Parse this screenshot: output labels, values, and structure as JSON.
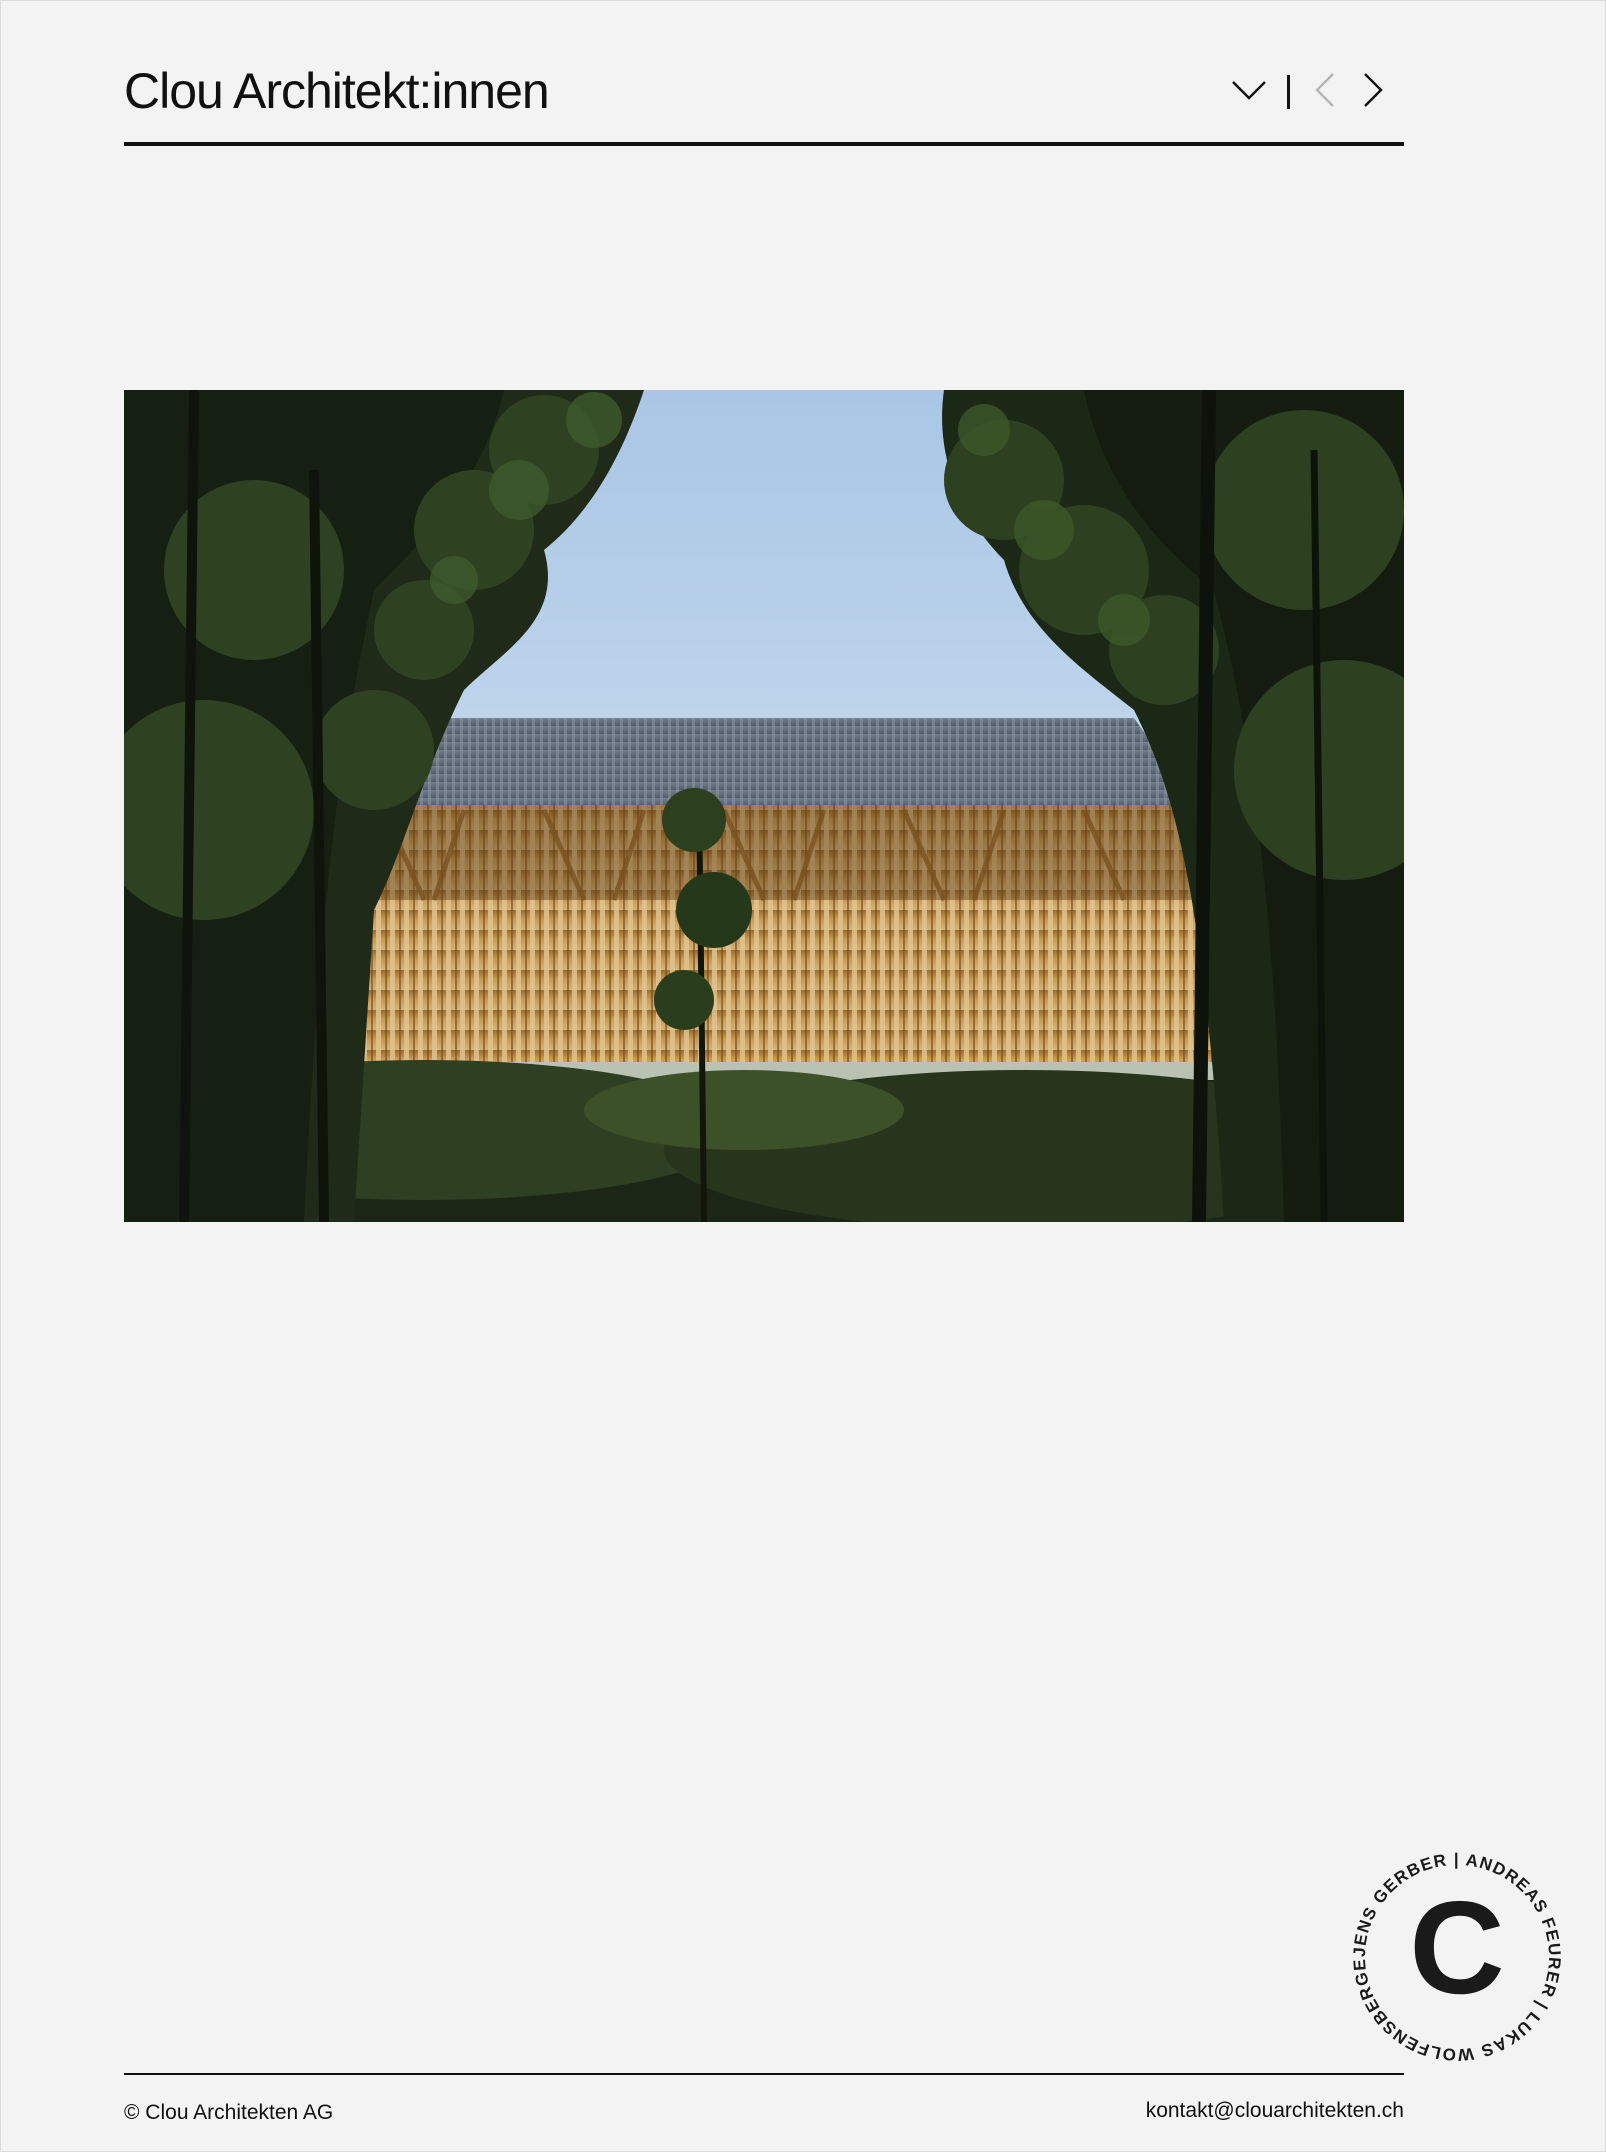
{
  "header": {
    "title": "Clou Architekt:innen",
    "nav": {
      "menu_icon": "chevron-down-icon",
      "prev_icon": "chevron-left-icon",
      "next_icon": "chevron-right-icon"
    }
  },
  "hero": {
    "image_description": "Timber structure behind trees with slatted facade and corrugated roof",
    "icon": "photo"
  },
  "stamp": {
    "letter": "C",
    "ring_text": "JENS GERBER | ANDREAS FEURER | LUKAS WOLFENSBERGER | "
  },
  "footer": {
    "copyright": "© Clou Architekten AG",
    "email": "kontakt@clouarchitekten.ch"
  },
  "colors": {
    "background": "#f3f3f3",
    "text": "#111111",
    "prev_disabled": "#b5b5b5"
  }
}
